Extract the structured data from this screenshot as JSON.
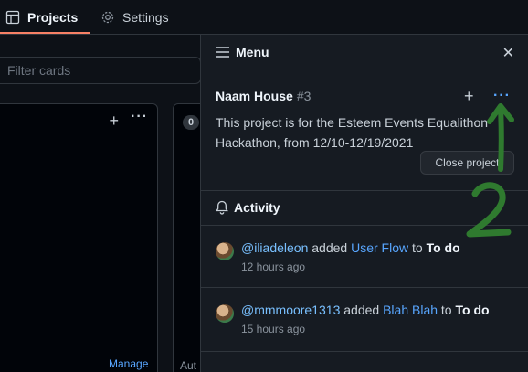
{
  "tabs": [
    {
      "label": "Projects",
      "icon": "table-icon"
    },
    {
      "label": "Settings",
      "icon": "gear-icon"
    }
  ],
  "filter": {
    "placeholder": "Filter cards"
  },
  "board": {
    "column1": {
      "add": "+",
      "more": "···",
      "footer_link": "Manage"
    },
    "column2": {
      "count": "0",
      "footer_text": "Aut"
    }
  },
  "menu": {
    "title": "Menu",
    "close": "✕",
    "project": {
      "name": "Naam House",
      "number": "#3",
      "add": "+",
      "more": "···",
      "description": "This project is for the Esteem Events Equalithon Hackathon, from 12/10-12/19/2021",
      "close_button": "Close project"
    },
    "activity": {
      "title": "Activity",
      "entries": [
        {
          "user": "@iliadeleon",
          "verb": "added",
          "item": "User Flow",
          "prep": "to",
          "column": "To do",
          "time": "12 hours ago"
        },
        {
          "user": "@mmmoore1313",
          "verb": "added",
          "item": "Blah Blah",
          "prep": "to",
          "column": "To do",
          "time": "15 hours ago"
        }
      ]
    }
  },
  "annotation": {
    "label": "2",
    "color": "#2f7a2f"
  },
  "colors": {
    "accent": "#58a6ff",
    "tab_underline": "#f78166",
    "background": "#0d1117",
    "panel": "#161b22"
  }
}
